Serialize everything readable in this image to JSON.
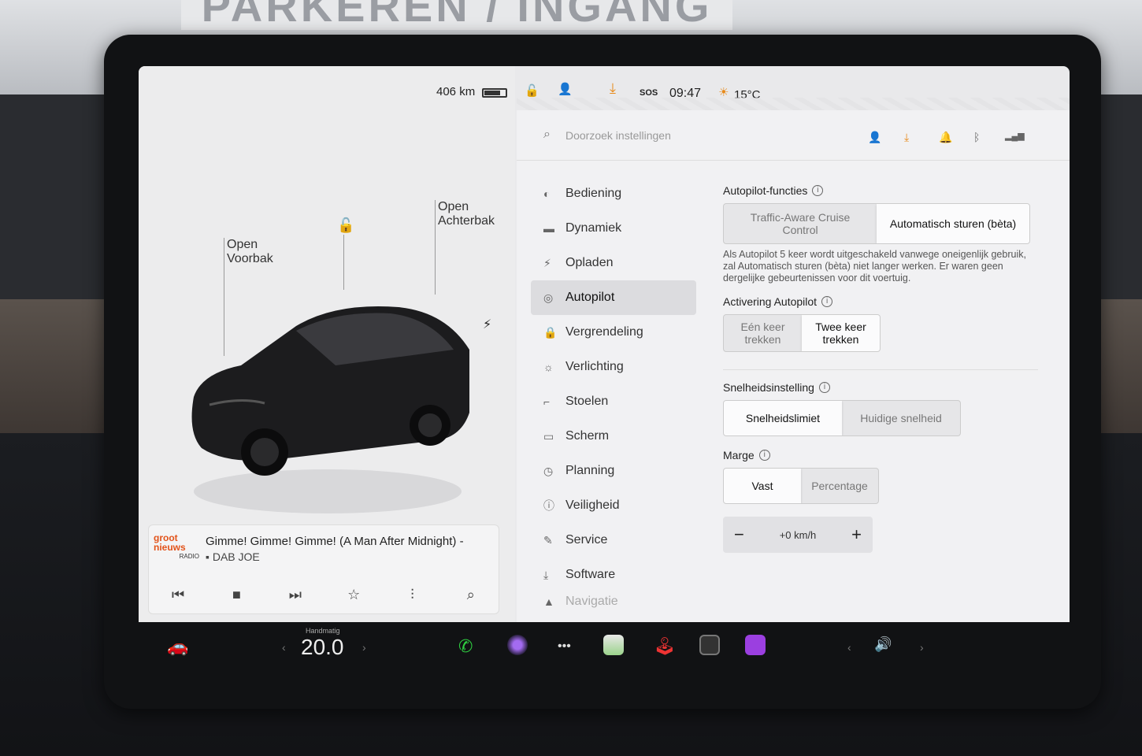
{
  "backdrop": {
    "sign": "PARKEREN / INGANG"
  },
  "status": {
    "range": "406 km",
    "battery_level": 0.75,
    "lock": "unlock-icon",
    "user": "user-icon",
    "download": "download-icon",
    "sos": "SOS",
    "time": "09:47",
    "temp": "15°C"
  },
  "car": {
    "frunk_label_1": "Open",
    "frunk_label_2": "Voorbak",
    "trunk_label_1": "Open",
    "trunk_label_2": "Achterbak"
  },
  "media": {
    "station_logo_1": "groot",
    "station_logo_2": "nieuws",
    "station_logo_3": "RADIO",
    "title": "Gimme! Gimme! Gimme! (A Man After Midnight) -",
    "source": "DAB JOE"
  },
  "settings": {
    "search_placeholder": "Doorzoek instellingen",
    "nav": [
      {
        "label": "Bediening"
      },
      {
        "label": "Dynamiek"
      },
      {
        "label": "Opladen"
      },
      {
        "label": "Autopilot"
      },
      {
        "label": "Vergrendeling"
      },
      {
        "label": "Verlichting"
      },
      {
        "label": "Stoelen"
      },
      {
        "label": "Scherm"
      },
      {
        "label": "Planning"
      },
      {
        "label": "Veiligheid"
      },
      {
        "label": "Service"
      },
      {
        "label": "Software"
      },
      {
        "label": "Navigatie"
      }
    ],
    "autopilot_features": {
      "title": "Autopilot-functies",
      "opt1": "Traffic-Aware Cruise Control",
      "opt2": "Automatisch sturen (bèta)",
      "desc": "Als Autopilot 5 keer wordt uitgeschakeld vanwege oneigenlijk gebruik, zal Automatisch sturen (bèta) niet langer werken. Er waren geen dergelijke gebeurtenissen voor dit voertuig."
    },
    "activation": {
      "title": "Activering Autopilot",
      "opt1": "Eén keer trekken",
      "opt2": "Twee keer trekken"
    },
    "speed": {
      "title": "Snelheidsinstelling",
      "opt1": "Snelheidslimiet",
      "opt2": "Huidige snelheid"
    },
    "margin": {
      "title": "Marge",
      "opt1": "Vast",
      "opt2": "Percentage",
      "minus": "−",
      "value": "+0 km/h",
      "plus": "+"
    }
  },
  "dock": {
    "climate_mode": "Handmatig",
    "temp": "20.0"
  }
}
